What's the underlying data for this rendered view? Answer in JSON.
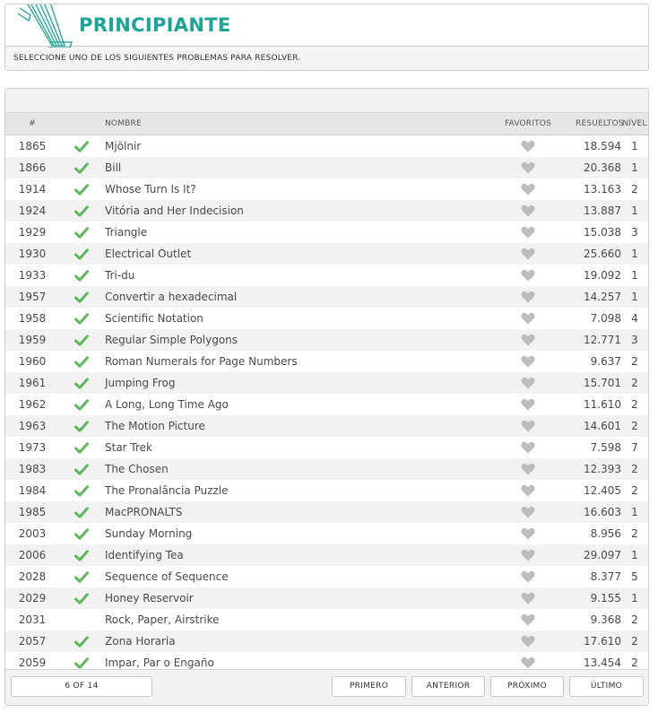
{
  "header": {
    "title": "PRINCIPIANTE",
    "subtitle": "SELECCIONE UNO DE LOS SIGUIENTES PROBLEMAS PARA RESOLVER.",
    "accent_color": "#1aa596"
  },
  "table": {
    "columns": {
      "id": "#",
      "name": "NOMBRE",
      "favorites": "FAVORITOS",
      "solved": "RESUELTOS",
      "level": "NÍVEL"
    },
    "icons": {
      "solved": "check-icon",
      "favorite": "heart-icon"
    },
    "colors": {
      "check": "#5cb85c",
      "heart": "#bdbdbd"
    },
    "rows": [
      {
        "id": "1865",
        "solved": true,
        "name": "Mjölnir",
        "solved_count": "18.594",
        "level": "1"
      },
      {
        "id": "1866",
        "solved": true,
        "name": "Bill",
        "solved_count": "20.368",
        "level": "1"
      },
      {
        "id": "1914",
        "solved": true,
        "name": "Whose Turn Is It?",
        "solved_count": "13.163",
        "level": "2"
      },
      {
        "id": "1924",
        "solved": true,
        "name": "Vitória and Her Indecision",
        "solved_count": "13.887",
        "level": "1"
      },
      {
        "id": "1929",
        "solved": true,
        "name": "Triangle",
        "solved_count": "15.038",
        "level": "3"
      },
      {
        "id": "1930",
        "solved": true,
        "name": "Electrical Outlet",
        "solved_count": "25.660",
        "level": "1"
      },
      {
        "id": "1933",
        "solved": true,
        "name": "Tri-du",
        "solved_count": "19.092",
        "level": "1"
      },
      {
        "id": "1957",
        "solved": true,
        "name": "Convertir a hexadecimal",
        "solved_count": "14.257",
        "level": "1"
      },
      {
        "id": "1958",
        "solved": true,
        "name": "Scientific Notation",
        "solved_count": "7.098",
        "level": "4"
      },
      {
        "id": "1959",
        "solved": true,
        "name": "Regular Simple Polygons",
        "solved_count": "12.771",
        "level": "3"
      },
      {
        "id": "1960",
        "solved": true,
        "name": "Roman Numerals for Page Numbers",
        "solved_count": "9.637",
        "level": "2"
      },
      {
        "id": "1961",
        "solved": true,
        "name": "Jumping Frog",
        "solved_count": "15.701",
        "level": "2"
      },
      {
        "id": "1962",
        "solved": true,
        "name": "A Long, Long Time Ago",
        "solved_count": "11.610",
        "level": "2"
      },
      {
        "id": "1963",
        "solved": true,
        "name": "The Motion Picture",
        "solved_count": "14.601",
        "level": "2"
      },
      {
        "id": "1973",
        "solved": true,
        "name": "Star Trek",
        "solved_count": "7.598",
        "level": "7"
      },
      {
        "id": "1983",
        "solved": true,
        "name": "The Chosen",
        "solved_count": "12.393",
        "level": "2"
      },
      {
        "id": "1984",
        "solved": true,
        "name": "The Pronalância Puzzle",
        "solved_count": "12.405",
        "level": "2"
      },
      {
        "id": "1985",
        "solved": true,
        "name": "MacPRONALTS",
        "solved_count": "16.603",
        "level": "1"
      },
      {
        "id": "2003",
        "solved": true,
        "name": "Sunday Morning",
        "solved_count": "8.956",
        "level": "2"
      },
      {
        "id": "2006",
        "solved": true,
        "name": "Identifying Tea",
        "solved_count": "29.097",
        "level": "1"
      },
      {
        "id": "2028",
        "solved": true,
        "name": "Sequence of Sequence",
        "solved_count": "8.377",
        "level": "5"
      },
      {
        "id": "2029",
        "solved": true,
        "name": "Honey Reservoir",
        "solved_count": "9.155",
        "level": "1"
      },
      {
        "id": "2031",
        "solved": false,
        "name": "Rock, Paper, Airstrike",
        "solved_count": "9.368",
        "level": "2"
      },
      {
        "id": "2057",
        "solved": true,
        "name": "Zona Horaria",
        "solved_count": "17.610",
        "level": "2"
      },
      {
        "id": "2059",
        "solved": true,
        "name": "Impar, Par o Engaño",
        "solved_count": "13.454",
        "level": "2"
      }
    ]
  },
  "pagination": {
    "indicator": "6 OF 14",
    "first": "PRIMERO",
    "previous": "ANTERIOR",
    "next": "PRÓXIMO",
    "last": "ÚLTIMO"
  }
}
